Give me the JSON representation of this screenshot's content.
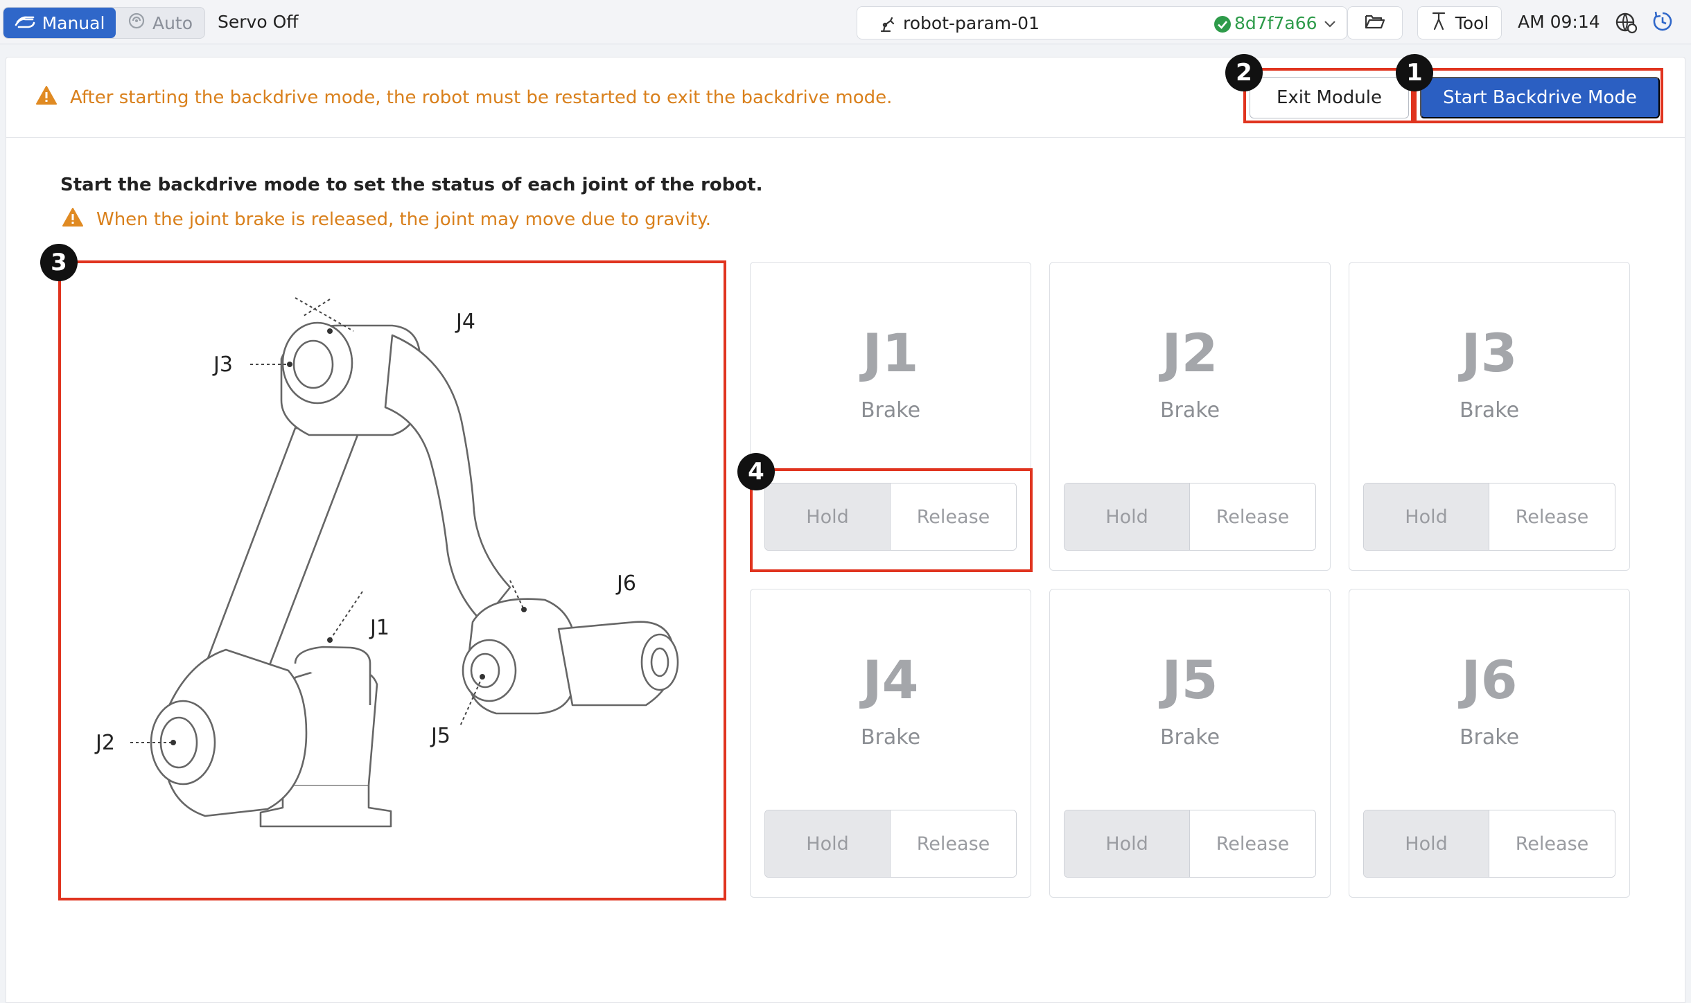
{
  "topbar": {
    "mode_manual": "Manual",
    "mode_auto": "Auto",
    "servo_status": "Servo Off",
    "param_name": "robot-param-01",
    "param_hash": "8d7f7a66",
    "tool_label": "Tool",
    "clock": "AM 09:14",
    "icons": [
      "hand-mode-icon",
      "auto-mode-icon",
      "robot-arm-icon",
      "check-circle-icon",
      "chevron-down-icon",
      "folder-open-icon",
      "tool-icon",
      "settings-globe-icon",
      "refresh-icon"
    ]
  },
  "banner": {
    "warning": "After starting the backdrive mode, the robot must be restarted to exit the backdrive mode.",
    "exit_label": "Exit Module",
    "start_label": "Start Backdrive Mode"
  },
  "main": {
    "instruction": "Start the backdrive mode to set the status of each joint of the robot.",
    "gravity_warning": "When the joint brake is released, the joint may move due to gravity."
  },
  "diagram": {
    "labels": [
      "J1",
      "J2",
      "J3",
      "J4",
      "J5",
      "J6"
    ]
  },
  "joints": [
    {
      "name": "J1",
      "sub": "Brake",
      "hold": "Hold",
      "release": "Release"
    },
    {
      "name": "J2",
      "sub": "Brake",
      "hold": "Hold",
      "release": "Release"
    },
    {
      "name": "J3",
      "sub": "Brake",
      "hold": "Hold",
      "release": "Release"
    },
    {
      "name": "J4",
      "sub": "Brake",
      "hold": "Hold",
      "release": "Release"
    },
    {
      "name": "J5",
      "sub": "Brake",
      "hold": "Hold",
      "release": "Release"
    },
    {
      "name": "J6",
      "sub": "Brake",
      "hold": "Hold",
      "release": "Release"
    }
  ],
  "annotations": [
    "1",
    "2",
    "3",
    "4"
  ],
  "colors": {
    "accent": "#2f67c9",
    "warning": "#d9801c",
    "ok": "#2e9b4a",
    "highlight": "#e0341f"
  }
}
